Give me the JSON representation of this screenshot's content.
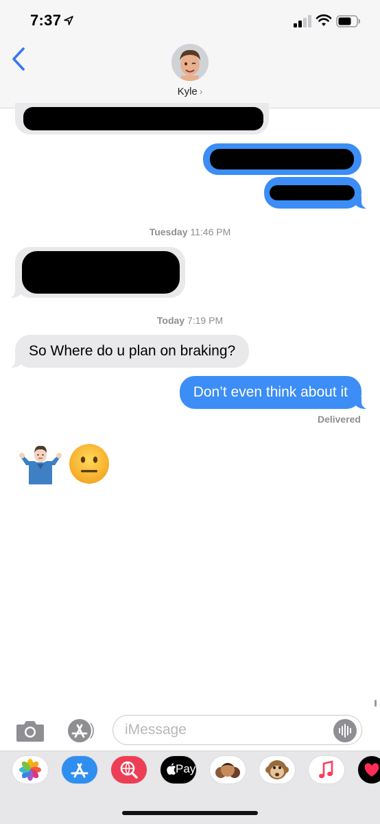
{
  "status_bar": {
    "time": "7:37"
  },
  "header": {
    "contact_name": "Kyle",
    "contact_chevron": "›",
    "back_icon": "chevron-left-icon"
  },
  "messages": {
    "timestamp1": {
      "day": "Tuesday",
      "time": "11:46 PM"
    },
    "timestamp2": {
      "day": "Today",
      "time": "7:19 PM"
    },
    "incoming_text": "So Where do u plan on braking?",
    "outgoing_text": "Don’t even think about it",
    "delivered": "Delivered",
    "emojis": [
      "man-shrugging",
      "neutral-face"
    ]
  },
  "input": {
    "placeholder": "iMessage"
  },
  "drawer": {
    "apps": [
      "photos",
      "app-store",
      "search-images",
      "apple-pay",
      "memoji-stickers",
      "animoji",
      "music",
      "digital-touch"
    ],
    "apple_pay_label": "Pay"
  },
  "colors": {
    "outgoing": "#3c8df5",
    "incoming": "#e9e9eb",
    "timestamp": "#8e8e93"
  }
}
